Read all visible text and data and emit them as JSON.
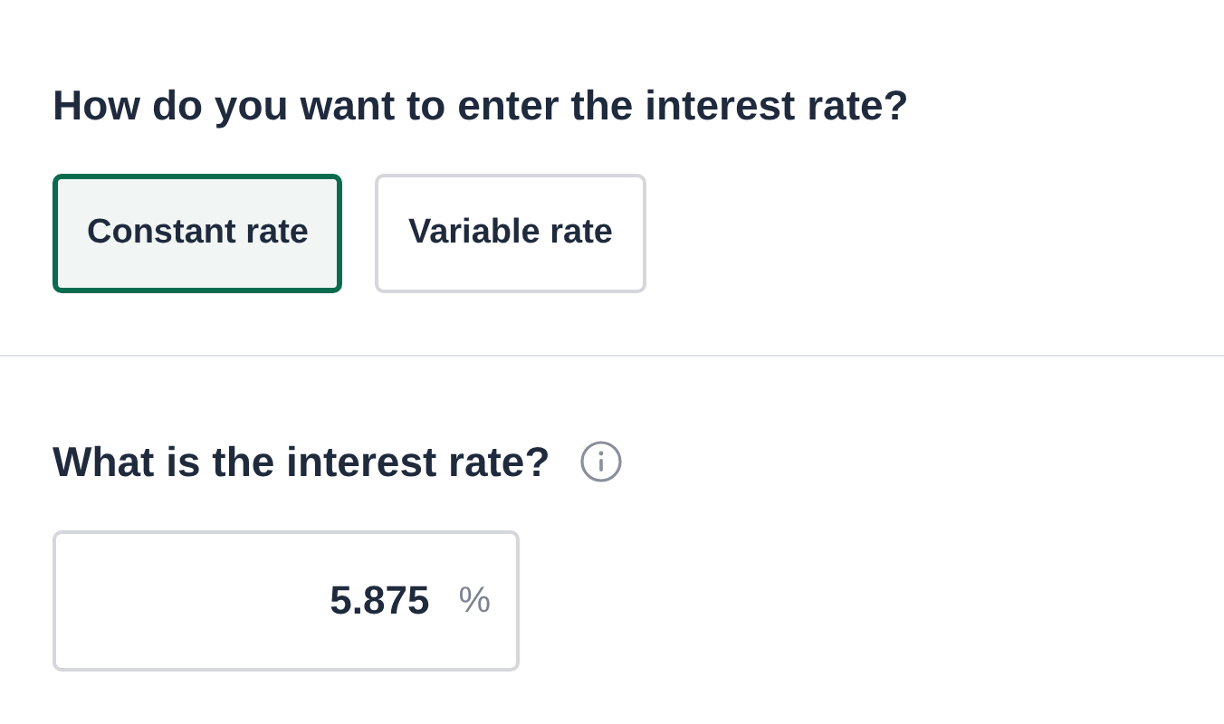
{
  "rate_type": {
    "question": "How do you want to enter the interest rate?",
    "options": [
      {
        "label": "Constant rate",
        "selected": true
      },
      {
        "label": "Variable rate",
        "selected": false
      }
    ]
  },
  "rate": {
    "question": "What is the interest rate?",
    "value": "5.875",
    "unit": "%"
  }
}
